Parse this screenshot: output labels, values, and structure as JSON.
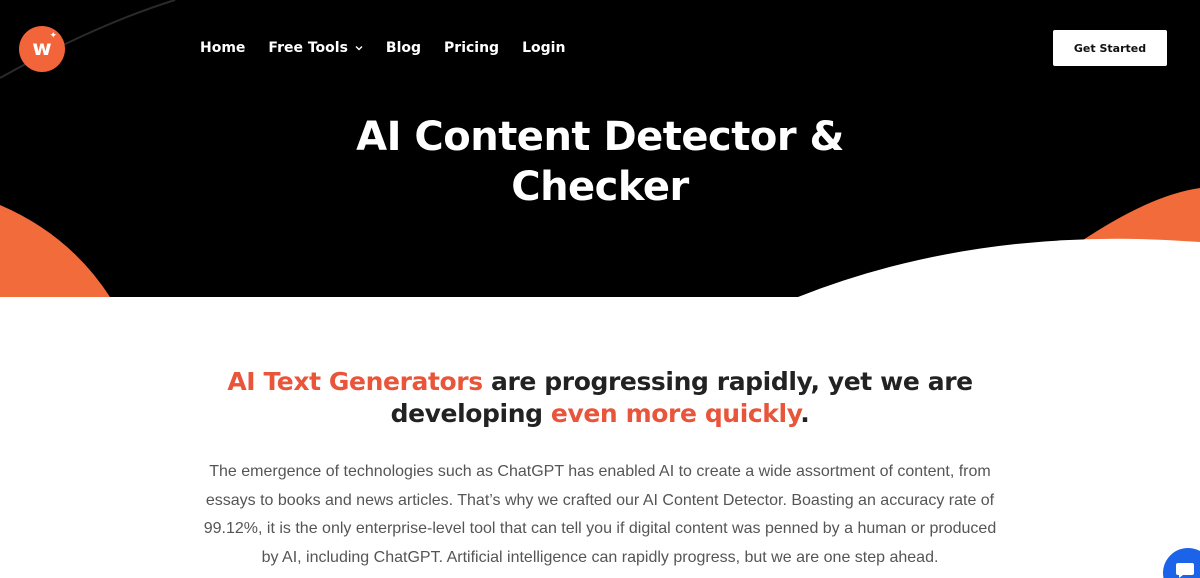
{
  "brand": {
    "logo_letter": "w",
    "logo_color": "#f2643a"
  },
  "nav": {
    "items": [
      {
        "label": "Home",
        "has_dropdown": false
      },
      {
        "label": "Free Tools",
        "has_dropdown": true
      },
      {
        "label": "Blog",
        "has_dropdown": false
      },
      {
        "label": "Pricing",
        "has_dropdown": false
      },
      {
        "label": "Login",
        "has_dropdown": false
      }
    ],
    "cta_label": "Get Started"
  },
  "hero": {
    "title": "AI Content Detector & Checker",
    "background": "#000000",
    "accent_color": "#f26b3a"
  },
  "content": {
    "headline_part1": "AI Text Generators",
    "headline_part2": " are progressing rapidly, yet we are developing ",
    "headline_part3": "even more quickly",
    "headline_part4": ".",
    "body": "The emergence of technologies such as ChatGPT has enabled AI to create a wide assortment of content, from essays to books and news articles. That’s why we crafted our AI Content Detector. Boasting an accuracy rate of 99.12%, it is the only enterprise-level tool that can tell you if digital content was penned by a human or produced by AI, including ChatGPT. Artificial intelligence can rapidly progress, but we are one step ahead.",
    "accent_color": "#e8553a"
  },
  "chat_widget": {
    "icon": "chat-bubble-icon",
    "color": "#1b63e8"
  }
}
